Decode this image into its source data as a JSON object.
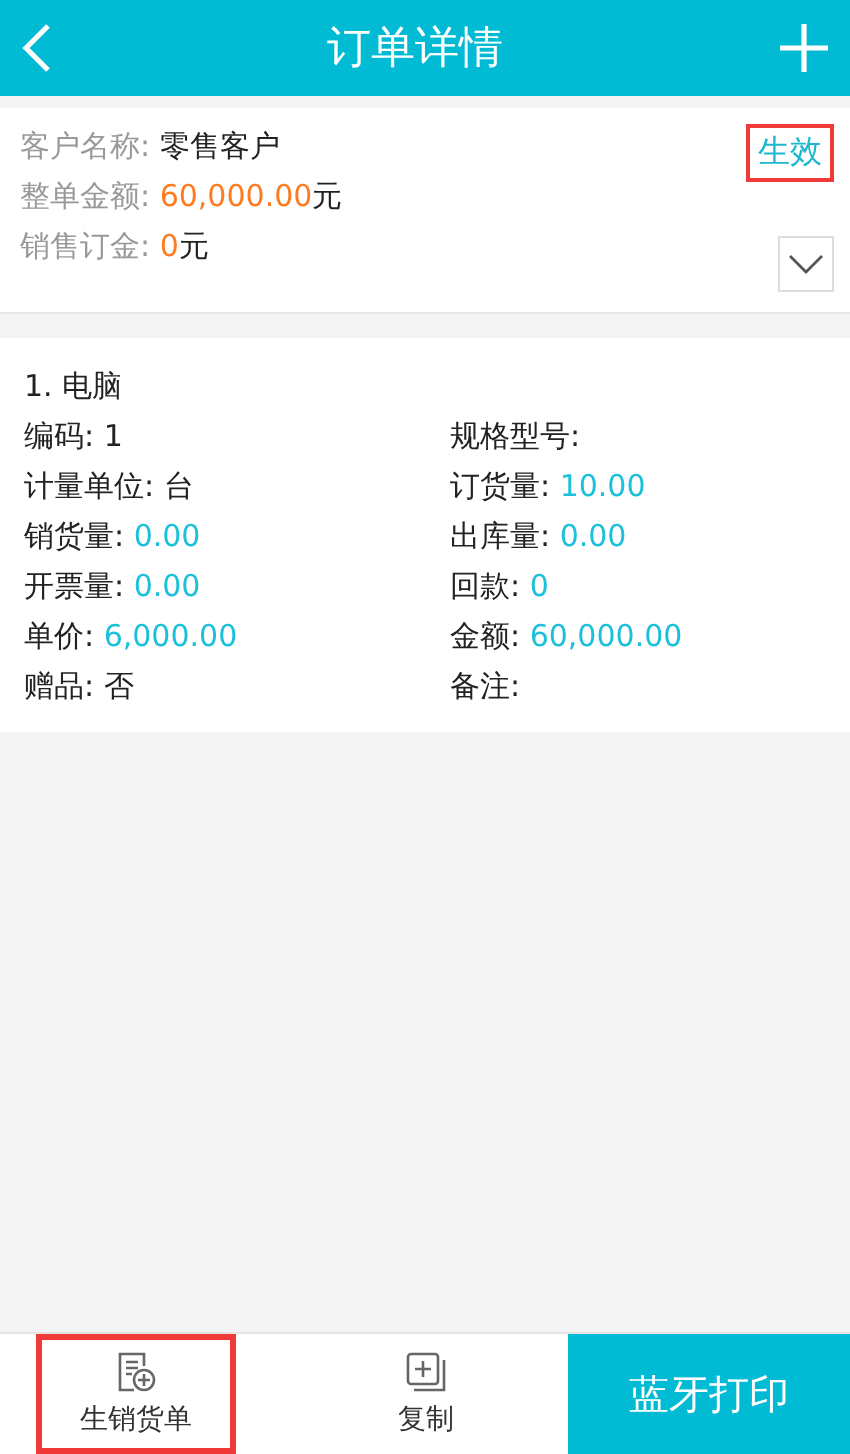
{
  "header": {
    "title": "订单详情"
  },
  "summary": {
    "status": {
      "label": "生效",
      "highlighted": true
    },
    "rows": [
      {
        "label": "客户名称: ",
        "value": "零售客户",
        "kind": "text"
      },
      {
        "label": "整单金额: ",
        "value": "60,000.00",
        "unit": "元",
        "kind": "amount"
      },
      {
        "label": "销售订金: ",
        "value": "0",
        "unit": "元",
        "kind": "amount"
      }
    ],
    "expanded": false
  },
  "items": [
    {
      "title": "1. 电脑",
      "fields": [
        {
          "label": "编码: ",
          "value": "1",
          "kind": "text"
        },
        {
          "label": "规格型号:"
        },
        {
          "label": "计量单位: ",
          "value": "台",
          "kind": "text"
        },
        {
          "label": "订货量: ",
          "value": "10.00",
          "kind": "number"
        },
        {
          "label": "销货量: ",
          "value": "0.00",
          "kind": "number"
        },
        {
          "label": "出库量: ",
          "value": "0.00",
          "kind": "number"
        },
        {
          "label": "开票量: ",
          "value": "0.00",
          "kind": "number"
        },
        {
          "label": "回款: ",
          "value": "0",
          "kind": "number"
        },
        {
          "label": "单价: ",
          "value": "6,000.00",
          "kind": "number"
        },
        {
          "label": "金额: ",
          "value": "60,000.00",
          "kind": "number"
        },
        {
          "label": "赠品: ",
          "value": "否",
          "kind": "text"
        },
        {
          "label": "备注:"
        }
      ]
    }
  ],
  "bottom_bar": [
    {
      "label": "生销货单",
      "kind": "doc",
      "highlighted": true
    },
    {
      "label": "复制",
      "kind": "copy",
      "highlighted": false
    },
    {
      "label": "蓝牙打印",
      "kind": "primary",
      "highlighted": false
    }
  ]
}
